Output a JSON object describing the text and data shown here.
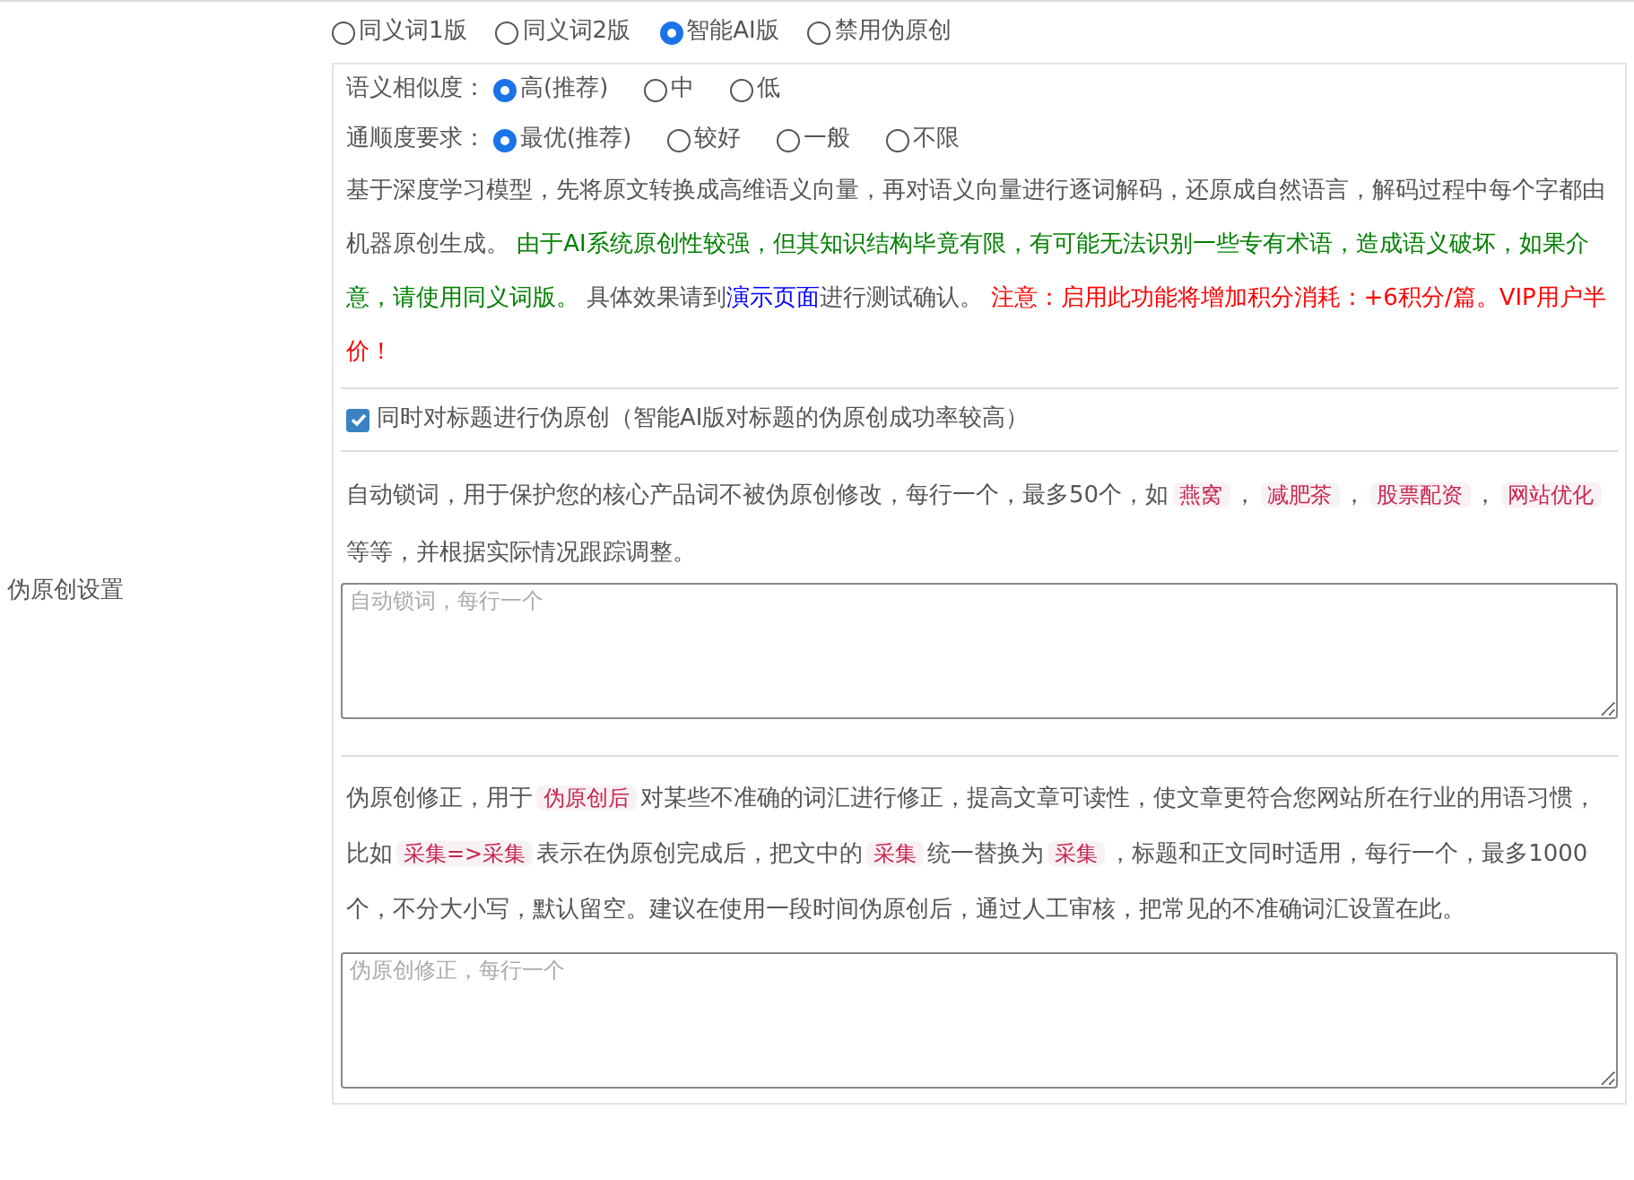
{
  "section_label": "伪原创设置",
  "mode_options": [
    {
      "label": "同义词1版",
      "selected": false
    },
    {
      "label": "同义词2版",
      "selected": false
    },
    {
      "label": "智能AI版",
      "selected": true
    },
    {
      "label": "禁用伪原创",
      "selected": false
    }
  ],
  "settings": [
    {
      "label": "语义相似度：",
      "options": [
        {
          "label": "高(推荐)",
          "selected": true
        },
        {
          "label": "中",
          "selected": false
        },
        {
          "label": "低",
          "selected": false
        }
      ]
    },
    {
      "label": "通顺度要求：",
      "options": [
        {
          "label": "最优(推荐)",
          "selected": true
        },
        {
          "label": "较好",
          "selected": false
        },
        {
          "label": "一般",
          "selected": false
        },
        {
          "label": "不限",
          "selected": false
        }
      ]
    }
  ],
  "ai_description": [
    {
      "kind": "text",
      "text": "基于深度学习模型，先将原文转换成高维语义向量，再对语义向量进行逐词解码，还原成自然语言，解码过程中每个字都由机器原创生成。 "
    },
    {
      "kind": "note",
      "text": "由于AI系统原创性较强，但其知识结构毕竟有限，有可能无法识别一些专有术语，造成语义破坏，如果介意，请使用同义词版。"
    },
    {
      "kind": "text",
      "text": " 具体效果请到"
    },
    {
      "kind": "link",
      "text": "演示页面"
    },
    {
      "kind": "text",
      "text": "进行测试确认。 "
    },
    {
      "kind": "warning",
      "text": "注意：启用此功能将增加积分消耗：+6积分/篇。VIP用户半价！"
    }
  ],
  "title_option": {
    "label": "同时对标题进行伪原创（智能AI版对标题的伪原创成功率较高）",
    "checked": true
  },
  "lock_words": {
    "description": [
      {
        "kind": "text",
        "text": "自动锁词，用于保护您的核心产品词不被伪原创修改，每行一个，最多50个，如"
      },
      {
        "kind": "code",
        "text": "燕窝"
      },
      {
        "kind": "text",
        "text": "，"
      },
      {
        "kind": "code",
        "text": "减肥茶"
      },
      {
        "kind": "text",
        "text": "，"
      },
      {
        "kind": "code",
        "text": "股票配资"
      },
      {
        "kind": "text",
        "text": "，"
      },
      {
        "kind": "code",
        "text": "网站优化"
      },
      {
        "kind": "text",
        "text": " 等等，并根据实际情况跟踪调整。"
      }
    ],
    "placeholder": "自动锁词，每行一个"
  },
  "correction": {
    "description": [
      {
        "kind": "text",
        "text": "伪原创修正，用于"
      },
      {
        "kind": "code",
        "text": "伪原创后"
      },
      {
        "kind": "text",
        "text": "对某些不准确的词汇进行修正，提高文章可读性，使文章更符合您网站所在行业的用语习惯，比如"
      },
      {
        "kind": "code",
        "text": "采集=>采集"
      },
      {
        "kind": "text",
        "text": "表示在伪原创完成后，把文中的"
      },
      {
        "kind": "code",
        "text": "采集"
      },
      {
        "kind": "text",
        "text": "统一替换为"
      },
      {
        "kind": "code",
        "text": "采集"
      },
      {
        "kind": "text",
        "text": "，标题和正文同时适用，每行一个，最多1000个，不分大小写，默认留空。建议在使用一段时间伪原创后，通过人工审核，把常见的不准确词汇设置在此。"
      }
    ],
    "placeholder": "伪原创修正，每行一个"
  }
}
